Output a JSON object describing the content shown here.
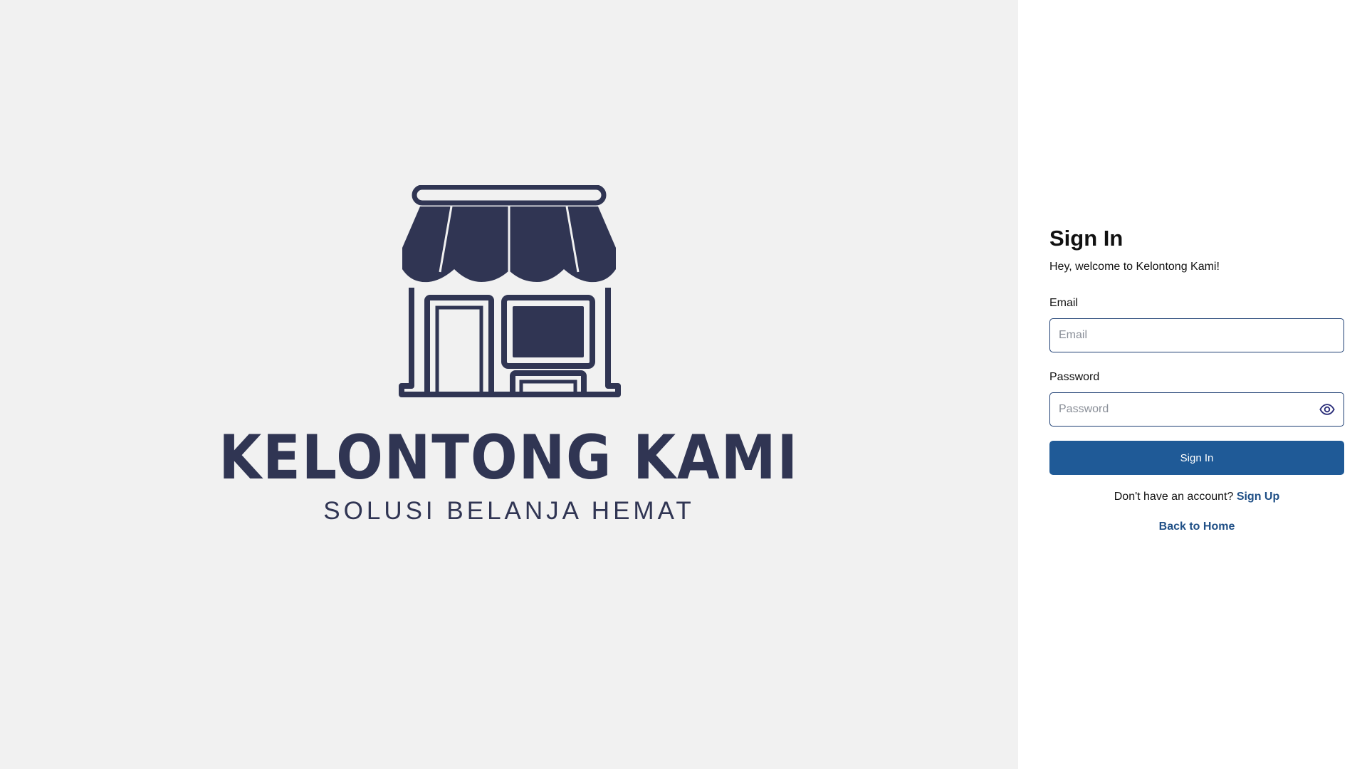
{
  "brand": {
    "name": "KELONTONG KAMI",
    "tagline": "SOLUSI BELANJA HEMAT",
    "logo_icon": "storefront-icon",
    "color": "#303553"
  },
  "colors": {
    "left_background": "#f1f1f1",
    "right_background": "#ffffff",
    "primary_button": "#1f5a97",
    "link": "#1f4f86",
    "input_border": "#1e3f73"
  },
  "form": {
    "title": "Sign In",
    "subtitle": "Hey, welcome to Kelontong Kami!",
    "email": {
      "label": "Email",
      "placeholder": "Email",
      "value": ""
    },
    "password": {
      "label": "Password",
      "placeholder": "Password",
      "value": "",
      "toggle_icon": "eye-icon"
    },
    "submit_label": "Sign In",
    "signup_prompt": "Don't have an account?",
    "signup_link": "Sign Up",
    "back_home_link": "Back to Home"
  }
}
